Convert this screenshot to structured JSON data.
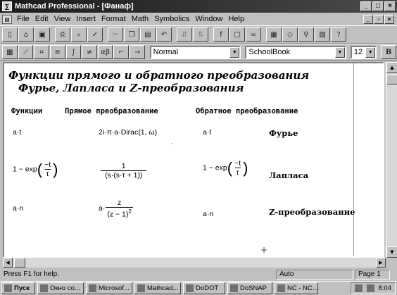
{
  "window": {
    "title": "Mathcad Professional - [Фанаф]",
    "minimize": "_",
    "maximize": "□",
    "close": "×"
  },
  "menu": {
    "items": [
      "File",
      "Edit",
      "View",
      "Insert",
      "Format",
      "Math",
      "Symbolics",
      "Window",
      "Help"
    ]
  },
  "format_toolbar": {
    "style_value": "Normal",
    "font_value": "SchoolBook",
    "size_value": "12",
    "bold_label": "B"
  },
  "worksheet": {
    "heading_line1": "Функции прямого и обратного преобразования",
    "heading_line2": "Фурье,  Лапласа и Z-преобразования",
    "col_function": "Функции",
    "col_forward": "Прямое преобразование",
    "col_inverse": "Обратное преобразование",
    "rows": [
      {
        "function": "a·t",
        "forward": "2i·π·a·Dirac(1, ω)",
        "inverse": "a·t",
        "label": "Фурье"
      },
      {
        "function_prefix": "1 − exp",
        "function_frac_num": "−t",
        "function_frac_den": "τ",
        "forward_num": "1",
        "forward_den": "(s·(s·τ + 1))",
        "inverse_prefix": "1 − exp",
        "inverse_frac_num": "−t",
        "inverse_frac_den": "τ",
        "label": "Лапласа"
      },
      {
        "function": "a·n",
        "forward_prefix": "a·",
        "forward_num": "z",
        "forward_den": "(z − 1)",
        "forward_den_exp": "2",
        "inverse": "a·n",
        "label": "Z-преобразование"
      }
    ]
  },
  "statusbar": {
    "help_text": "Press F1 for help.",
    "mode": "Auto",
    "page": "Page 1"
  },
  "taskbar": {
    "start": "Пуск",
    "tasks": [
      "Окно со...",
      "Microsof...",
      "Mathcad...",
      "DoDOT",
      "DoSNAP",
      "NC - NC..."
    ],
    "clock": "8:04"
  }
}
